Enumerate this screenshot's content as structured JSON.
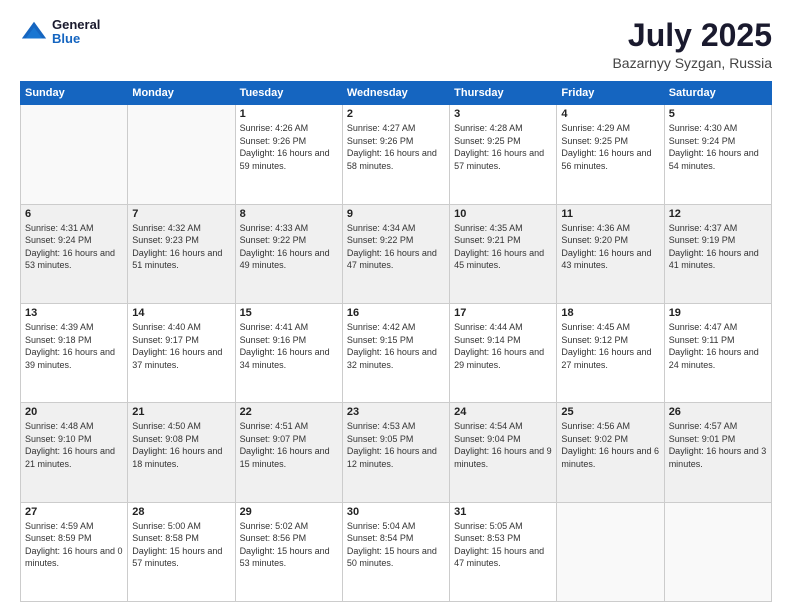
{
  "header": {
    "logo": {
      "general": "General",
      "blue": "Blue"
    },
    "title": "July 2025",
    "location": "Bazarnyy Syzgan, Russia"
  },
  "days_of_week": [
    "Sunday",
    "Monday",
    "Tuesday",
    "Wednesday",
    "Thursday",
    "Friday",
    "Saturday"
  ],
  "weeks": [
    [
      {
        "day": "",
        "sunrise": "",
        "sunset": "",
        "daylight": ""
      },
      {
        "day": "",
        "sunrise": "",
        "sunset": "",
        "daylight": ""
      },
      {
        "day": "1",
        "sunrise": "Sunrise: 4:26 AM",
        "sunset": "Sunset: 9:26 PM",
        "daylight": "Daylight: 16 hours and 59 minutes."
      },
      {
        "day": "2",
        "sunrise": "Sunrise: 4:27 AM",
        "sunset": "Sunset: 9:26 PM",
        "daylight": "Daylight: 16 hours and 58 minutes."
      },
      {
        "day": "3",
        "sunrise": "Sunrise: 4:28 AM",
        "sunset": "Sunset: 9:25 PM",
        "daylight": "Daylight: 16 hours and 57 minutes."
      },
      {
        "day": "4",
        "sunrise": "Sunrise: 4:29 AM",
        "sunset": "Sunset: 9:25 PM",
        "daylight": "Daylight: 16 hours and 56 minutes."
      },
      {
        "day": "5",
        "sunrise": "Sunrise: 4:30 AM",
        "sunset": "Sunset: 9:24 PM",
        "daylight": "Daylight: 16 hours and 54 minutes."
      }
    ],
    [
      {
        "day": "6",
        "sunrise": "Sunrise: 4:31 AM",
        "sunset": "Sunset: 9:24 PM",
        "daylight": "Daylight: 16 hours and 53 minutes."
      },
      {
        "day": "7",
        "sunrise": "Sunrise: 4:32 AM",
        "sunset": "Sunset: 9:23 PM",
        "daylight": "Daylight: 16 hours and 51 minutes."
      },
      {
        "day": "8",
        "sunrise": "Sunrise: 4:33 AM",
        "sunset": "Sunset: 9:22 PM",
        "daylight": "Daylight: 16 hours and 49 minutes."
      },
      {
        "day": "9",
        "sunrise": "Sunrise: 4:34 AM",
        "sunset": "Sunset: 9:22 PM",
        "daylight": "Daylight: 16 hours and 47 minutes."
      },
      {
        "day": "10",
        "sunrise": "Sunrise: 4:35 AM",
        "sunset": "Sunset: 9:21 PM",
        "daylight": "Daylight: 16 hours and 45 minutes."
      },
      {
        "day": "11",
        "sunrise": "Sunrise: 4:36 AM",
        "sunset": "Sunset: 9:20 PM",
        "daylight": "Daylight: 16 hours and 43 minutes."
      },
      {
        "day": "12",
        "sunrise": "Sunrise: 4:37 AM",
        "sunset": "Sunset: 9:19 PM",
        "daylight": "Daylight: 16 hours and 41 minutes."
      }
    ],
    [
      {
        "day": "13",
        "sunrise": "Sunrise: 4:39 AM",
        "sunset": "Sunset: 9:18 PM",
        "daylight": "Daylight: 16 hours and 39 minutes."
      },
      {
        "day": "14",
        "sunrise": "Sunrise: 4:40 AM",
        "sunset": "Sunset: 9:17 PM",
        "daylight": "Daylight: 16 hours and 37 minutes."
      },
      {
        "day": "15",
        "sunrise": "Sunrise: 4:41 AM",
        "sunset": "Sunset: 9:16 PM",
        "daylight": "Daylight: 16 hours and 34 minutes."
      },
      {
        "day": "16",
        "sunrise": "Sunrise: 4:42 AM",
        "sunset": "Sunset: 9:15 PM",
        "daylight": "Daylight: 16 hours and 32 minutes."
      },
      {
        "day": "17",
        "sunrise": "Sunrise: 4:44 AM",
        "sunset": "Sunset: 9:14 PM",
        "daylight": "Daylight: 16 hours and 29 minutes."
      },
      {
        "day": "18",
        "sunrise": "Sunrise: 4:45 AM",
        "sunset": "Sunset: 9:12 PM",
        "daylight": "Daylight: 16 hours and 27 minutes."
      },
      {
        "day": "19",
        "sunrise": "Sunrise: 4:47 AM",
        "sunset": "Sunset: 9:11 PM",
        "daylight": "Daylight: 16 hours and 24 minutes."
      }
    ],
    [
      {
        "day": "20",
        "sunrise": "Sunrise: 4:48 AM",
        "sunset": "Sunset: 9:10 PM",
        "daylight": "Daylight: 16 hours and 21 minutes."
      },
      {
        "day": "21",
        "sunrise": "Sunrise: 4:50 AM",
        "sunset": "Sunset: 9:08 PM",
        "daylight": "Daylight: 16 hours and 18 minutes."
      },
      {
        "day": "22",
        "sunrise": "Sunrise: 4:51 AM",
        "sunset": "Sunset: 9:07 PM",
        "daylight": "Daylight: 16 hours and 15 minutes."
      },
      {
        "day": "23",
        "sunrise": "Sunrise: 4:53 AM",
        "sunset": "Sunset: 9:05 PM",
        "daylight": "Daylight: 16 hours and 12 minutes."
      },
      {
        "day": "24",
        "sunrise": "Sunrise: 4:54 AM",
        "sunset": "Sunset: 9:04 PM",
        "daylight": "Daylight: 16 hours and 9 minutes."
      },
      {
        "day": "25",
        "sunrise": "Sunrise: 4:56 AM",
        "sunset": "Sunset: 9:02 PM",
        "daylight": "Daylight: 16 hours and 6 minutes."
      },
      {
        "day": "26",
        "sunrise": "Sunrise: 4:57 AM",
        "sunset": "Sunset: 9:01 PM",
        "daylight": "Daylight: 16 hours and 3 minutes."
      }
    ],
    [
      {
        "day": "27",
        "sunrise": "Sunrise: 4:59 AM",
        "sunset": "Sunset: 8:59 PM",
        "daylight": "Daylight: 16 hours and 0 minutes."
      },
      {
        "day": "28",
        "sunrise": "Sunrise: 5:00 AM",
        "sunset": "Sunset: 8:58 PM",
        "daylight": "Daylight: 15 hours and 57 minutes."
      },
      {
        "day": "29",
        "sunrise": "Sunrise: 5:02 AM",
        "sunset": "Sunset: 8:56 PM",
        "daylight": "Daylight: 15 hours and 53 minutes."
      },
      {
        "day": "30",
        "sunrise": "Sunrise: 5:04 AM",
        "sunset": "Sunset: 8:54 PM",
        "daylight": "Daylight: 15 hours and 50 minutes."
      },
      {
        "day": "31",
        "sunrise": "Sunrise: 5:05 AM",
        "sunset": "Sunset: 8:53 PM",
        "daylight": "Daylight: 15 hours and 47 minutes."
      },
      {
        "day": "",
        "sunrise": "",
        "sunset": "",
        "daylight": ""
      },
      {
        "day": "",
        "sunrise": "",
        "sunset": "",
        "daylight": ""
      }
    ]
  ]
}
